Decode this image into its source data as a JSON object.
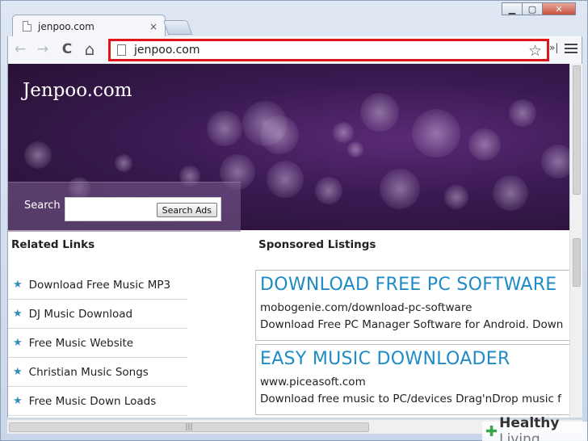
{
  "window": {
    "minimize_glyph": "▁",
    "maximize_glyph": "▢",
    "close_glyph": "✕"
  },
  "tab": {
    "title": "jenpoo.com",
    "close_glyph": "×"
  },
  "toolbar": {
    "back_glyph": "←",
    "forward_glyph": "→",
    "reload_glyph": "C",
    "home_glyph": "⌂",
    "url": "jenpoo.com",
    "star_glyph": "☆",
    "extensions_glyph": "»|"
  },
  "banner": {
    "site_title": "Jenpoo.com",
    "search_label": "Search",
    "search_button": "Search Ads"
  },
  "left": {
    "heading": "Related Links",
    "links": [
      "Download Free Music MP3",
      "DJ Music Download",
      "Free Music Website",
      "Christian Music Songs",
      "Free Music Down Loads"
    ]
  },
  "right": {
    "heading": "Sponsored Listings",
    "ads": [
      {
        "title": "DOWNLOAD FREE PC SOFTWARE",
        "url": "mobogenie.com/download-pc-software",
        "desc": "Download Free PC Manager Software for Android. Down"
      },
      {
        "title": "EASY MUSIC DOWNLOADER",
        "url": "www.piceasoft.com",
        "desc": "Download free music to PC/devices Drag'nDrop music f"
      }
    ]
  },
  "watermark": {
    "brand_bold": "Healthy",
    "brand_light": " Living"
  },
  "colors": {
    "highlight": "#e0161b",
    "ad_title": "#1e8bc6",
    "star": "#2e8fb8"
  }
}
